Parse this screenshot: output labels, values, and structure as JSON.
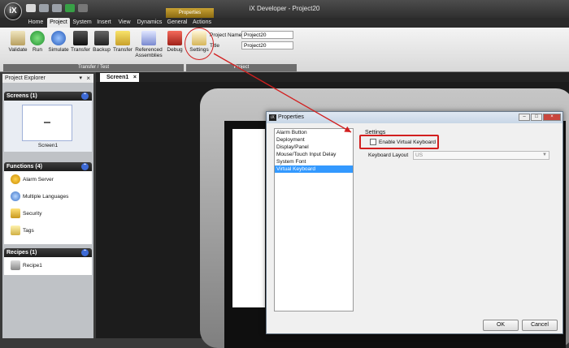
{
  "window": {
    "title": "iX Developer - Project20",
    "logo": "iX"
  },
  "tabs": [
    {
      "label": "Home"
    },
    {
      "label": "Project"
    },
    {
      "label": "System"
    },
    {
      "label": "Insert"
    },
    {
      "label": "View"
    },
    {
      "label": "Dynamics"
    },
    {
      "label": "General"
    },
    {
      "label": "Actions"
    }
  ],
  "contextual_tab": "Properties",
  "ribbon": {
    "buttons": [
      {
        "label": "Validate",
        "icon": "clipboard-check-icon"
      },
      {
        "label": "Run",
        "icon": "play-icon"
      },
      {
        "label": "Simulate",
        "icon": "play-blue-icon"
      },
      {
        "label": "Transfer",
        "icon": "monitor-icon"
      },
      {
        "label": "Backup",
        "icon": "backup-icon"
      },
      {
        "label": "Transfer",
        "icon": "transfer-text-icon"
      },
      {
        "label": "Referenced Assemblies",
        "icon": "assemblies-icon"
      },
      {
        "label": "Debug",
        "icon": "debug-icon"
      },
      {
        "label": "Settings",
        "icon": "settings-envelope-icon"
      }
    ],
    "group_transfer": "Transfer / Test",
    "group_project": "Project",
    "project_name_label": "Project Name",
    "project_name_value": "Project20",
    "title_label": "Title",
    "title_value": "Project20"
  },
  "project_explorer": {
    "title": "Project Explorer",
    "close": "×",
    "screens": {
      "header": "Screens (1)",
      "items": [
        "Screen1"
      ]
    },
    "functions": {
      "header": "Functions (4)",
      "items": [
        {
          "label": "Alarm Server",
          "icon": "alarm-bell-icon"
        },
        {
          "label": "Multiple Languages",
          "icon": "globe-person-icon"
        },
        {
          "label": "Security",
          "icon": "padlock-icon"
        },
        {
          "label": "Tags",
          "icon": "tags-icon"
        }
      ]
    },
    "recipes": {
      "header": "Recipes (1)",
      "items": [
        "Recipe1"
      ]
    }
  },
  "document_tab": "Screen1",
  "document_tab_close": "×",
  "dialog": {
    "title": "Properties",
    "list_items": [
      "Alarm Button",
      "Deployment",
      "Display/Panel",
      "Mouse/Touch Input Delay",
      "System Font",
      "Virtual Keyboard"
    ],
    "selected_index": 5,
    "settings_header": "Settings",
    "enable_virtual_keyboard_label": "Enable Virtual Keyboard",
    "enable_virtual_keyboard_checked": false,
    "keyboard_layout_label": "Keyboard Layout",
    "keyboard_layout_value": "US",
    "ok_label": "OK",
    "cancel_label": "Cancel"
  },
  "colors": {
    "accent_red": "#d21f1f",
    "selection_blue": "#3399ff",
    "context_tab_gold": "#c9a233"
  }
}
